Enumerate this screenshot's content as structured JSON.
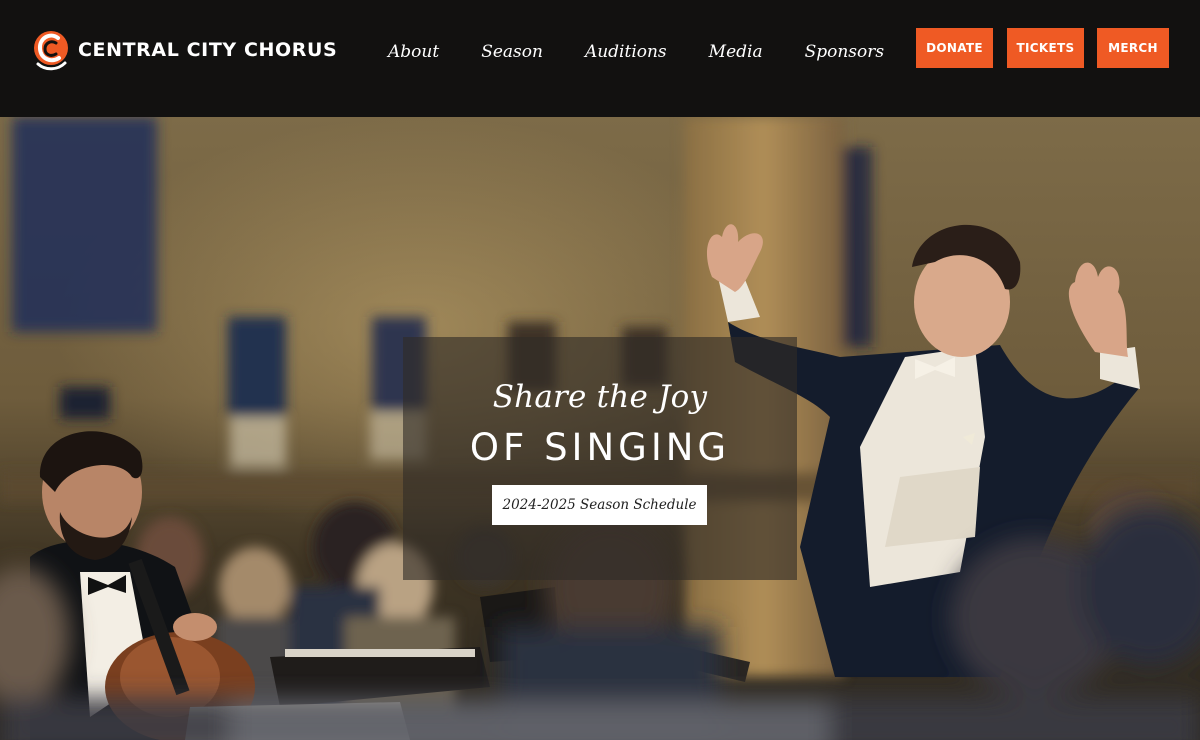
{
  "brand": {
    "name": "CENTRAL CITY CHORUS",
    "logo_icon": "ccc-monogram-icon",
    "accent_color": "#ef5a24",
    "header_bg": "#121110"
  },
  "nav": {
    "items": [
      {
        "label": "About"
      },
      {
        "label": "Season"
      },
      {
        "label": "Auditions"
      },
      {
        "label": "Media"
      },
      {
        "label": "Sponsors"
      }
    ]
  },
  "cta": {
    "donate": "DONATE",
    "tickets": "TICKETS",
    "merch": "MERCH"
  },
  "hero": {
    "image_subject": "conductor-leading-orchestra-photo",
    "tagline_top": "Share the Joy",
    "tagline_bottom": "OF SINGING",
    "button_label": "2024-2025 Season Schedule"
  }
}
